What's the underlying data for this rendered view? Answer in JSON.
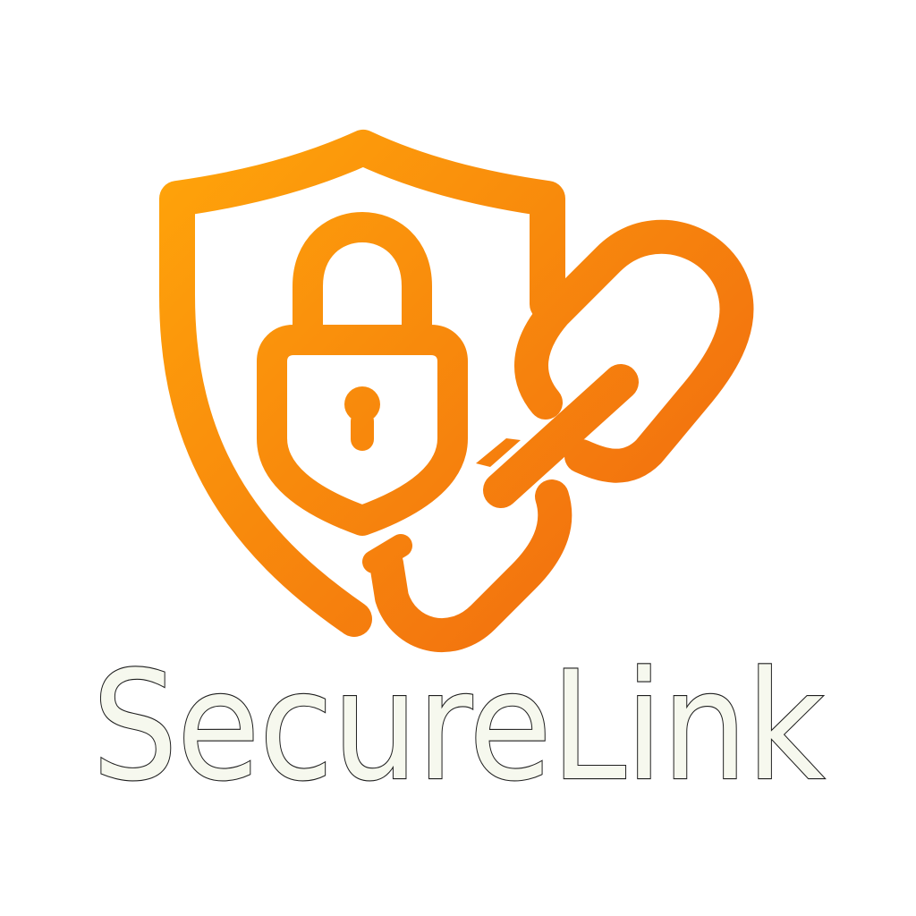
{
  "brand": {
    "name": "SecureLink",
    "gradient_start": "#ffa50a",
    "gradient_end": "#f06a0f",
    "wordmark_fill": "#f6f8ee",
    "wordmark_outline": "#1e1e1e",
    "background": "#ffffff"
  },
  "icons": [
    "shield-icon",
    "padlock-icon",
    "keyhole-icon",
    "chain-link-icon"
  ]
}
